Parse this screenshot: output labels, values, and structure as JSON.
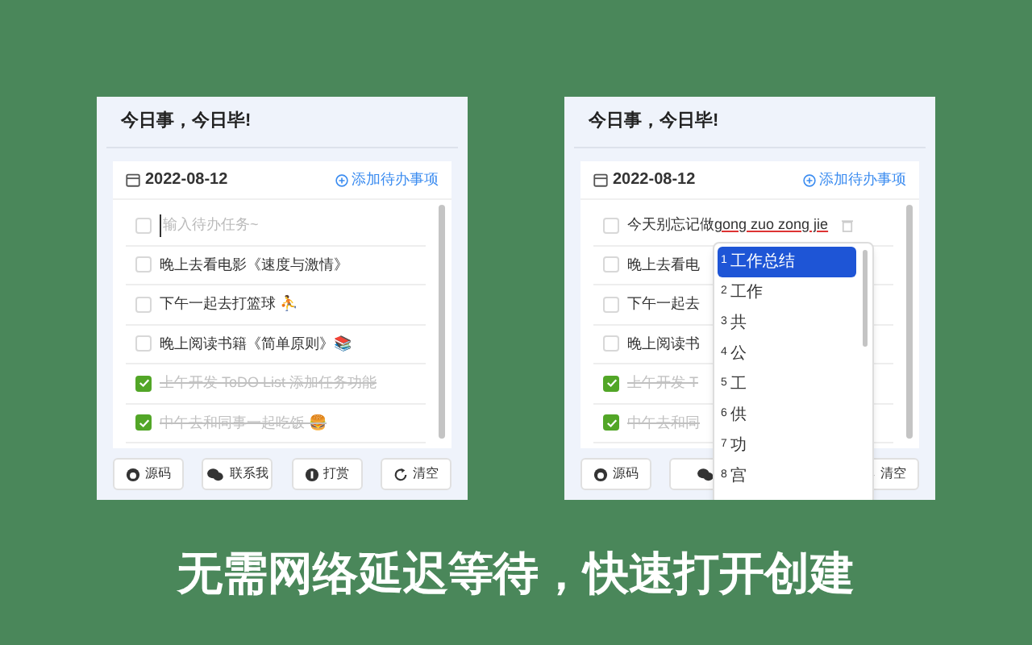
{
  "panels": [
    {
      "title": "今日事，今日毕!",
      "date": "2022-08-12",
      "add_link": "添加待办事项",
      "todos": [
        {
          "kind": "input",
          "placeholder": "输入待办任务~",
          "checked": false
        },
        {
          "kind": "task",
          "text": "晚上去看电影《速度与激情》",
          "checked": false
        },
        {
          "kind": "task",
          "text": "下午一起去打篮球 ⛹",
          "checked": false
        },
        {
          "kind": "task",
          "text": "晚上阅读书籍《简单原则》📚",
          "checked": false
        },
        {
          "kind": "task",
          "text": "上午开发 ToDO List 添加任务功能",
          "checked": true
        },
        {
          "kind": "task",
          "text": "中午去和同事一起吃饭 🍔",
          "checked": true
        }
      ],
      "buttons": [
        {
          "kind": "github",
          "label": "源码"
        },
        {
          "kind": "wechat",
          "label": "联系我"
        },
        {
          "kind": "coin",
          "label": "打赏"
        },
        {
          "kind": "refresh",
          "label": "清空"
        }
      ]
    },
    {
      "title": "今日事，今日毕!",
      "date": "2022-08-12",
      "add_link": "添加待办事项",
      "todos": [
        {
          "kind": "editing",
          "text": "今天别忘记做",
          "composing": "gong zuo zong jie",
          "checked": false
        },
        {
          "kind": "task",
          "text": "晚上去看电",
          "checked": false
        },
        {
          "kind": "task",
          "text": "下午一起去",
          "checked": false
        },
        {
          "kind": "task",
          "text": "晚上阅读书",
          "checked": false
        },
        {
          "kind": "task",
          "text": "上午开发 T",
          "checked": true
        },
        {
          "kind": "task",
          "text": "中午去和同",
          "checked": true
        }
      ],
      "buttons": [
        {
          "kind": "github",
          "label": "源码"
        },
        {
          "kind": "wechat"
        },
        {
          "kind": "refresh",
          "label": "清空"
        }
      ],
      "candidates": [
        {
          "index": "1",
          "text": "工作总结",
          "selected": true
        },
        {
          "index": "2",
          "text": "工作",
          "selected": false
        },
        {
          "index": "3",
          "text": "共",
          "selected": false
        },
        {
          "index": "4",
          "text": "公",
          "selected": false
        },
        {
          "index": "5",
          "text": "工",
          "selected": false
        },
        {
          "index": "6",
          "text": "供",
          "selected": false
        },
        {
          "index": "7",
          "text": "功",
          "selected": false
        },
        {
          "index": "8",
          "text": "宫",
          "selected": false
        }
      ]
    }
  ],
  "caption": "无需网络延迟等待，快速打开创建"
}
